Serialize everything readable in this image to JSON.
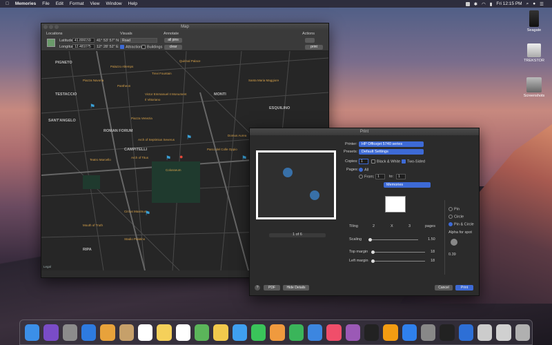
{
  "menubar": {
    "app": "Memories",
    "items": [
      "File",
      "Edit",
      "Format",
      "View",
      "Window",
      "Help"
    ],
    "clock": "Fri 12:15 PM"
  },
  "desktop": [
    {
      "label": "Seagate"
    },
    {
      "label": "TREKSTOR"
    },
    {
      "label": "Screenshots"
    }
  ],
  "map_window": {
    "title": "Map",
    "locations": {
      "label": "Locations",
      "latitude_label": "Latitude",
      "latitude": "41.899159",
      "latitude_dms": "41° 53' 57\" N",
      "longitude_label": "Longitude",
      "longitude": "12.481075",
      "longitude_dms": "12° 28' 52\" E"
    },
    "visuals": {
      "label": "Visuals",
      "mode": "Road",
      "attractions": "Attractions",
      "buildings": "Buildings"
    },
    "annotate": {
      "label": "Annotate",
      "all_pins": "all pins",
      "clear": "clear"
    },
    "actions": {
      "label": "Actions",
      "print": "print"
    },
    "map_labels": {
      "districts": [
        "PIGNETO",
        "TESTACCIO",
        "CAMPITELLI",
        "SANT'ANGELO",
        "MONTI",
        "ESQUILINO",
        "RIPA",
        "ROMAN FORUM"
      ],
      "places": [
        "Victor Emmanuel II Monument",
        "Il Vittoriano",
        "Quirinal Palace",
        "Trevi Fountain",
        "Santa Maria Maggiore",
        "Colosseum",
        "Circus Maximus",
        "Piazza Venezia",
        "Mouth of Truth",
        "Arch of Titus",
        "Arch of Septimius Severus",
        "Palazzo Altemps",
        "Teatro Marcello",
        "Domus Aurea",
        "Parco del Colle Oppio",
        "Stadio Palatino",
        "Piazza Navona",
        "Pantheon"
      ],
      "legal": "Legal"
    }
  },
  "print_dialog": {
    "title": "Print",
    "printer_label": "Printer:",
    "printer": "HP Officejet 5740 series",
    "presets_label": "Presets:",
    "presets": "Default Settings",
    "copies_label": "Copies:",
    "copies": "1",
    "bw": "Black & White",
    "two_sided": "Two-Sided",
    "pages_label": "Pages:",
    "all": "All",
    "from": "From:",
    "from_val": "1",
    "to": "to:",
    "to_val": "1",
    "section": "Memories",
    "page_indicator": "1 of 6",
    "tiling_label": "Tiling",
    "tiling_x": "2",
    "x": "X",
    "tiling_y": "3",
    "pages": "pages",
    "scaling_label": "Scaling",
    "scaling": "1.50",
    "top_margin_label": "Top margin",
    "top_margin": "18",
    "left_margin_label": "Left margin",
    "left_margin": "18",
    "pin": "Pin",
    "circle": "Circle",
    "pin_circle": "Pin & Circle",
    "alpha_label": "Alpha for spot",
    "alpha": "0.39",
    "help": "?",
    "pdf": "PDF",
    "hide_details": "Hide Details",
    "cancel": "Cancel",
    "print": "Print"
  },
  "dock": {
    "icons": [
      "finder-icon",
      "siri-icon",
      "launchpad-icon",
      "safari-icon",
      "photos-icon",
      "contacts-icon",
      "calendar-icon",
      "notes-icon",
      "reminders-icon",
      "maps-icon",
      "photos-app-icon",
      "messages-icon",
      "facetime-icon",
      "pages-icon",
      "numbers-icon",
      "keynote-icon",
      "itunes-icon",
      "podcasts-icon",
      "tv-icon",
      "books-icon",
      "appstore-icon",
      "preferences-icon",
      "terminal-icon",
      "xcode-icon",
      "preview-icon",
      "downloads-icon",
      "trash-icon"
    ]
  }
}
